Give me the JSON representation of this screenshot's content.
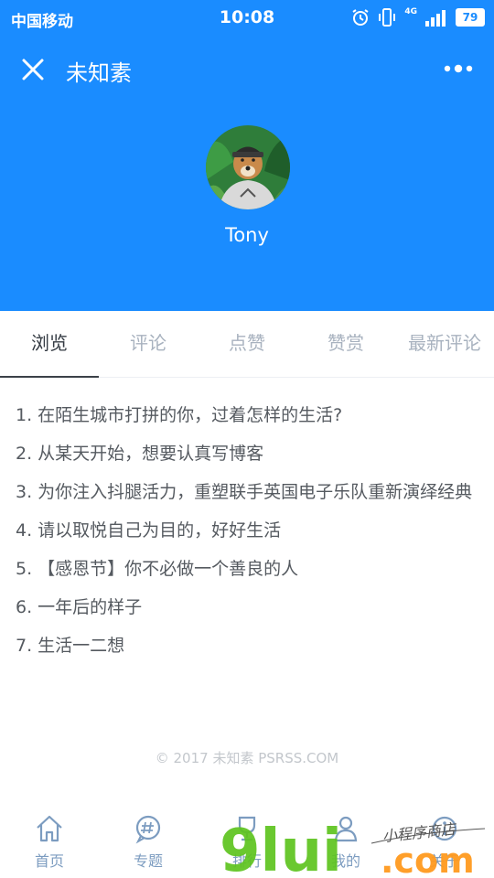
{
  "status_bar": {
    "carrier": "中国移动",
    "time": "10:08",
    "network": "4G",
    "battery": "79"
  },
  "nav": {
    "title": "未知素"
  },
  "profile": {
    "name": "Tony"
  },
  "tabs": [
    {
      "label": "浏览",
      "active": true
    },
    {
      "label": "评论",
      "active": false
    },
    {
      "label": "点赞",
      "active": false
    },
    {
      "label": "赞赏",
      "active": false
    },
    {
      "label": "最新评论",
      "active": false
    }
  ],
  "articles": [
    "1. 在陌生城市打拼的你，过着怎样的生活?",
    "2. 从某天开始，想要认真写博客",
    "3. 为你注入抖腿活力，重塑联手英国电子乐队重新演绎经典",
    "4. 请以取悦自己为目的，好好生活",
    "5. 【感恩节】你不必做一个善良的人",
    "6. 一年后的样子",
    "7. 生活一二想"
  ],
  "footer": "© 2017 未知素 PSRSS.COM",
  "bottom_nav": [
    {
      "label": "首页",
      "icon": "home-icon"
    },
    {
      "label": "专题",
      "icon": "hashtag-icon"
    },
    {
      "label": "排行",
      "icon": "trophy-icon"
    },
    {
      "label": "我的",
      "icon": "person-icon"
    },
    {
      "label": "关于",
      "icon": "info-icon"
    }
  ],
  "watermark": {
    "logo": "9lui.com",
    "tagline": "小程序商店"
  },
  "colors": {
    "primary": "#1a8cff",
    "tab_active": "#333a42",
    "tab_inactive": "#a8b2bf",
    "list_text": "#555a60",
    "bottom_nav": "#7c9cc0"
  }
}
